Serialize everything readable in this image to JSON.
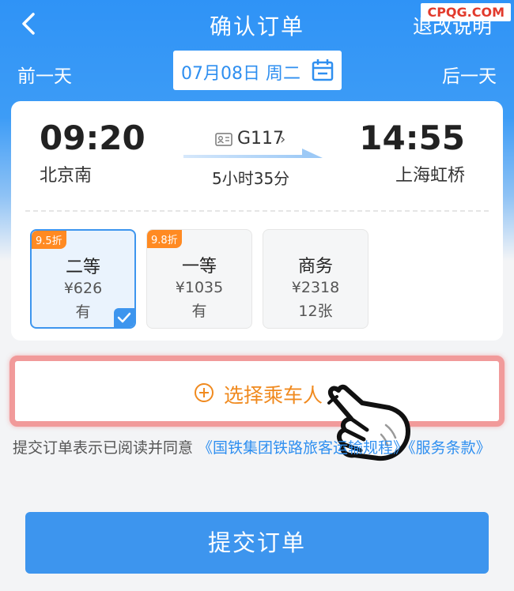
{
  "header": {
    "title": "确认订单",
    "explain_label": "退改说明",
    "watermark": "CPQG.COM"
  },
  "date_bar": {
    "prev_label": "前一天",
    "date_label": "07月08日 周二",
    "next_label": "后一天"
  },
  "train": {
    "depart_time": "09:20",
    "depart_station": "北京南",
    "arrive_time": "14:55",
    "arrive_station": "上海虹桥",
    "number": "G117",
    "duration": "5小时35分"
  },
  "seats": [
    {
      "discount": "9.5折",
      "name": "二等",
      "price": "¥626",
      "availability": "有",
      "selected": true
    },
    {
      "discount": "9.8折",
      "name": "一等",
      "price": "¥1035",
      "availability": "有",
      "selected": false
    },
    {
      "discount": "",
      "name": "商务",
      "price": "¥2318",
      "availability": "12张",
      "selected": false
    }
  ],
  "passenger": {
    "select_label": "选择乘车人"
  },
  "agreement": {
    "prefix": "提交订单表示已阅读并同意 ",
    "link1": "《国铁集团铁路旅客运输规程》",
    "link2": "《服务条款》"
  },
  "submit_label": "提交订单",
  "colors": {
    "primary": "#3d95ee",
    "accent_orange": "#f08a1f",
    "discount_badge": "#ff8a22",
    "highlight_border": "#f19a9a"
  }
}
